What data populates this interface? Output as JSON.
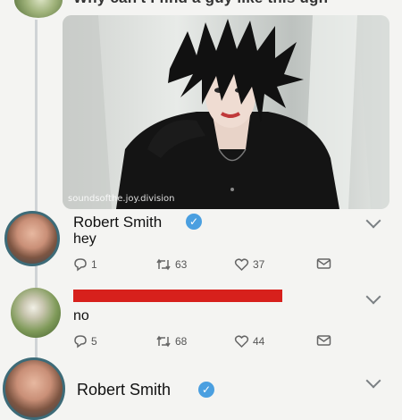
{
  "top_tweet": {
    "cut_text": "Why can't I find a guy like this ugh",
    "watermark": "soundsofthe.joy.division"
  },
  "replies": [
    {
      "name": "Robert Smith",
      "text": "hey",
      "reply_count": "1",
      "retweet_count": "63",
      "like_count": "37",
      "verified": true
    },
    {
      "name": "",
      "name_redacted": true,
      "text": "no",
      "reply_count": "5",
      "retweet_count": "68",
      "like_count": "44",
      "verified": false
    },
    {
      "name": "Robert Smith",
      "text": "",
      "verified": true
    }
  ],
  "icons": {
    "verified": "✓",
    "reply": "reply-icon",
    "retweet": "retweet-icon",
    "like": "heart-icon",
    "share": "mail-icon",
    "more": "chevron-down-icon"
  },
  "colors": {
    "verified": "#4a9fe0",
    "redaction": "#d7201c",
    "thread_line": "#cfd3d6"
  }
}
